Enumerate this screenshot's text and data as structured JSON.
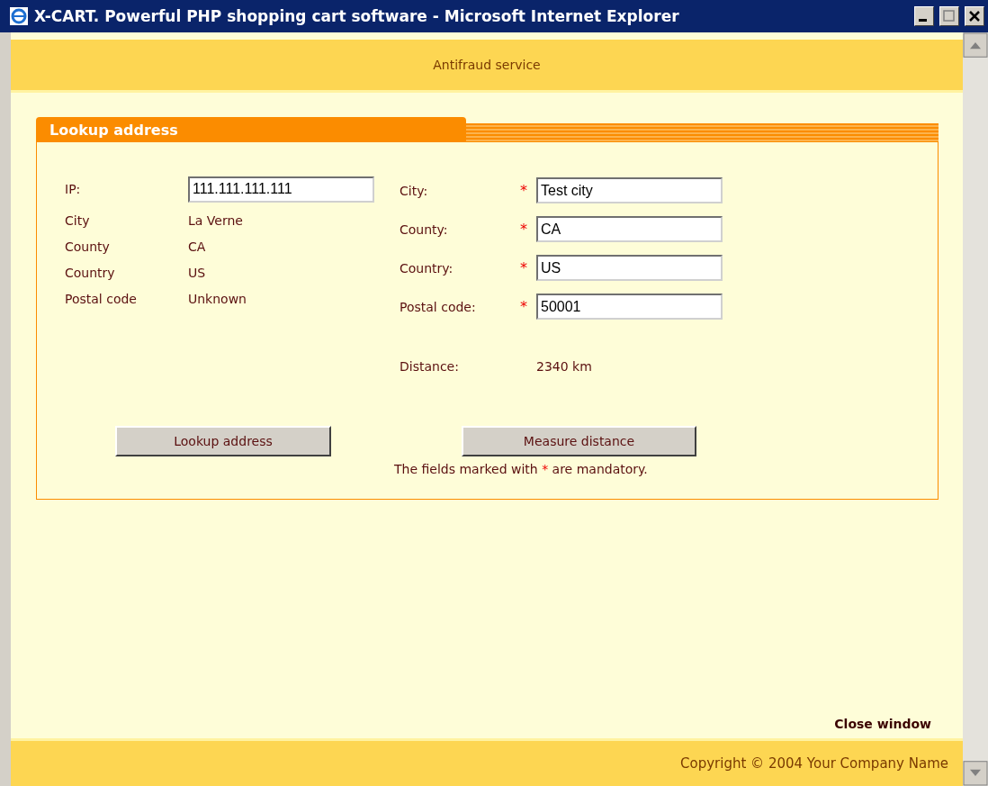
{
  "window": {
    "title": "X-CART. Powerful PHP shopping cart software - Microsoft Internet Explorer"
  },
  "header": {
    "title": "Antifraud service"
  },
  "panel": {
    "title": "Lookup address",
    "lookup": {
      "ip_label": "IP:",
      "ip_value": "111.111.111.111",
      "rows": [
        {
          "label": "City",
          "value": "La Verne"
        },
        {
          "label": "County",
          "value": "CA"
        },
        {
          "label": "Country",
          "value": "US"
        },
        {
          "label": "Postal code",
          "value": "Unknown"
        }
      ]
    },
    "address": {
      "fields": [
        {
          "label": "City:",
          "required": true,
          "value": "Test city"
        },
        {
          "label": "County:",
          "required": true,
          "value": "CA"
        },
        {
          "label": "Country:",
          "required": true,
          "value": "US"
        },
        {
          "label": "Postal code:",
          "required": true,
          "value": "50001"
        }
      ],
      "distance_label": "Distance:",
      "distance_value": "2340 km"
    },
    "buttons": [
      "Lookup address",
      "Measure distance"
    ],
    "note": {
      "before": "The fields marked with",
      "mark": "*",
      "after": "are mandatory."
    }
  },
  "close_link": "Close window",
  "footer": {
    "copyright": "Copyright © 2004 Your Company Name"
  }
}
